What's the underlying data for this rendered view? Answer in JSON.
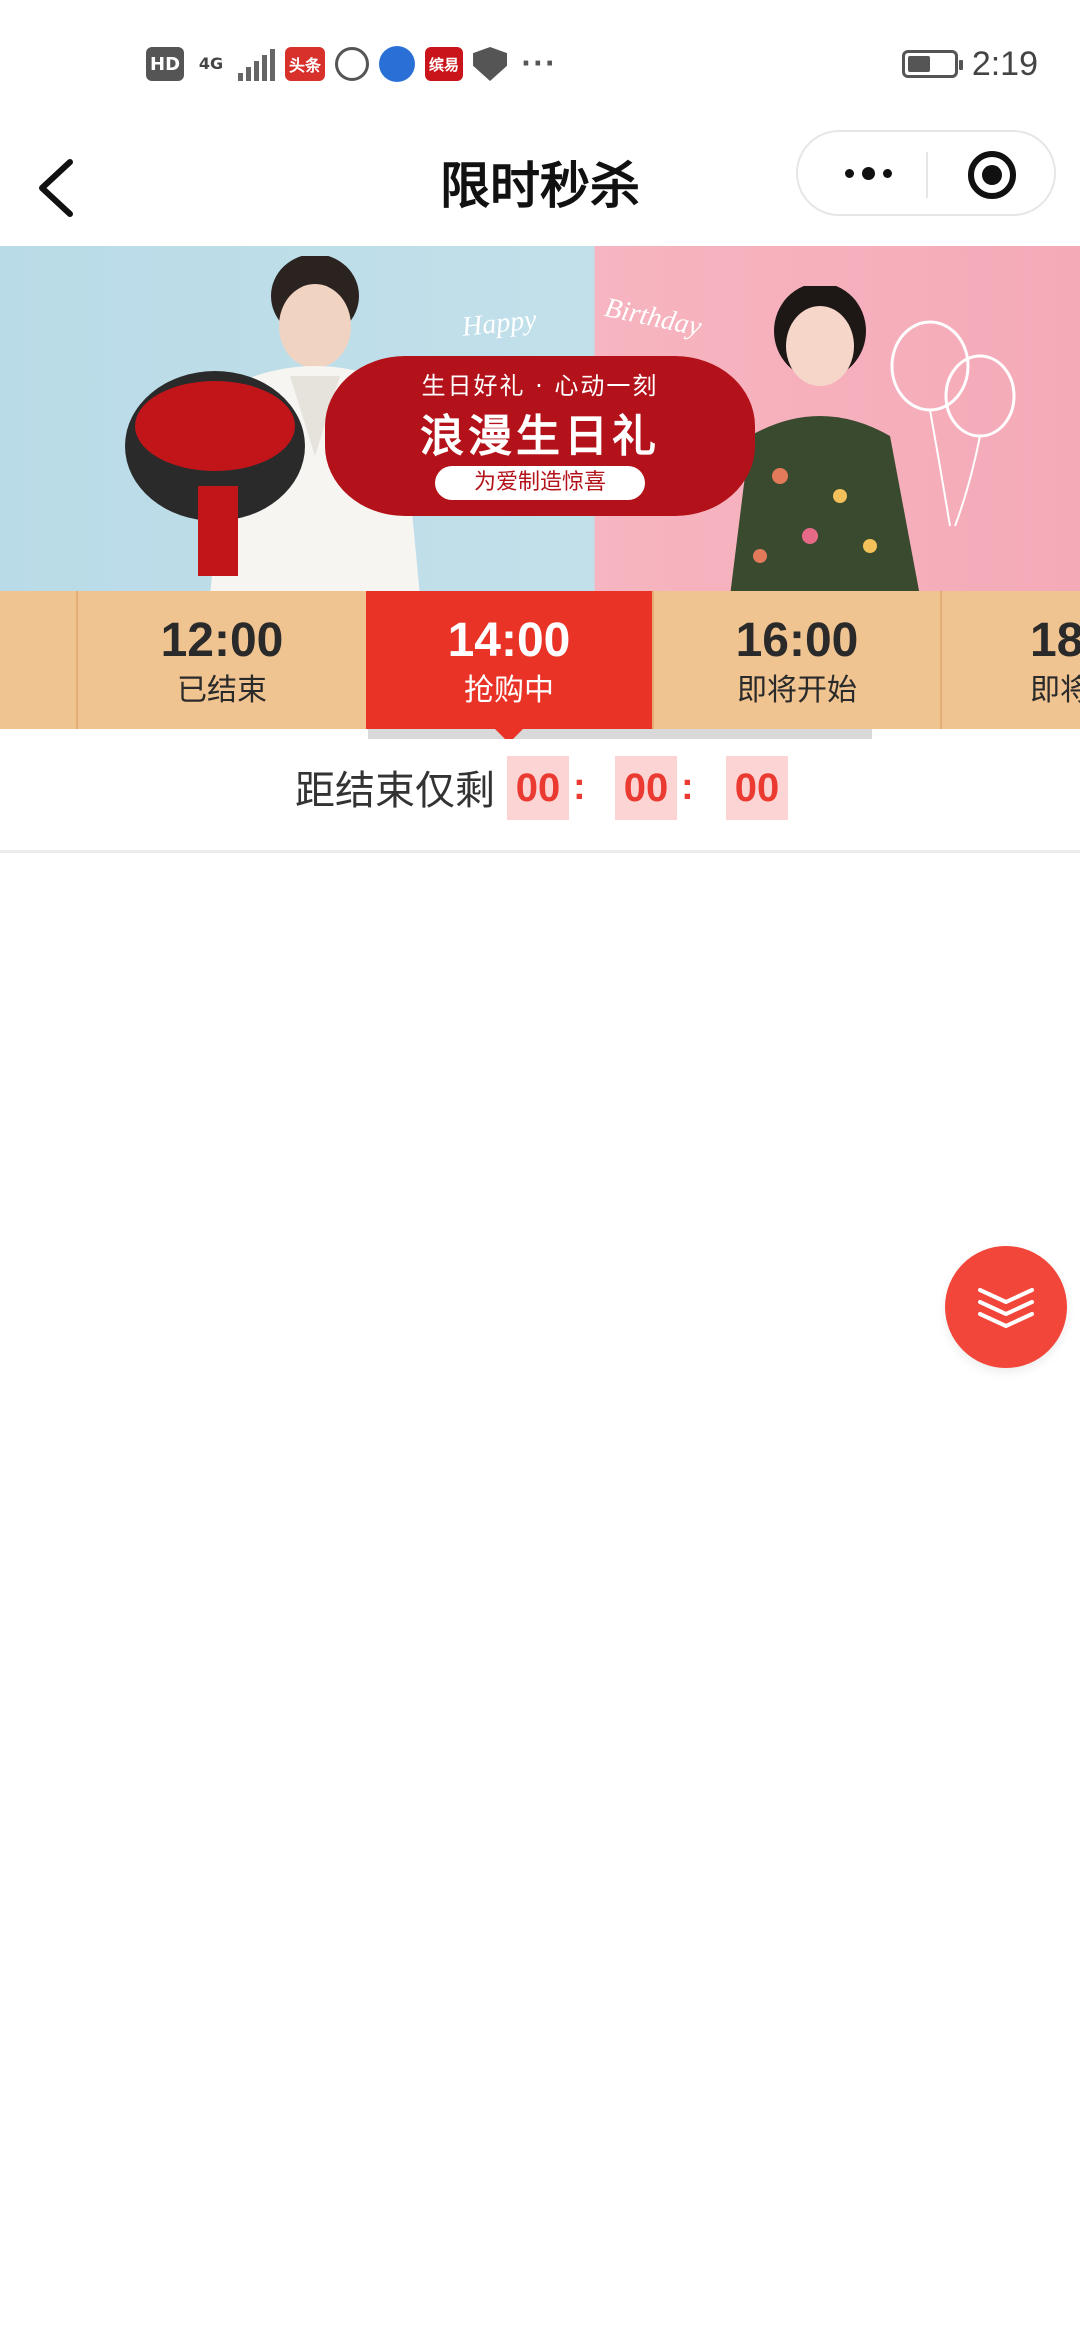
{
  "status_bar": {
    "time": "2:19",
    "left_icons": [
      "hd-icon",
      "4g-signal-icon",
      "toutiao-app-icon",
      "globe-icon",
      "app-blue-icon",
      "app-red-icon",
      "shield-icon",
      "more-dots-icon"
    ],
    "hd_label": "HD",
    "net_label": "4G",
    "toutiao_label": "头条",
    "red_app_label": "缤易"
  },
  "nav": {
    "title": "限时秒杀"
  },
  "banner": {
    "subtitle": "生日好礼 · 心动一刻",
    "headline": "浪漫生日礼",
    "pill": "为爱制造惊喜",
    "happy": "Happy",
    "birthday": "Birthday"
  },
  "time_tabs": [
    {
      "time": "12:00",
      "status": "已结束",
      "active": false
    },
    {
      "time": "14:00",
      "status": "抢购中",
      "active": true
    },
    {
      "time": "16:00",
      "status": "即将开始",
      "active": false
    },
    {
      "time": "18",
      "status": "即将",
      "active": false
    }
  ],
  "countdown": {
    "label": "距结束仅剩",
    "hours": "00",
    "minutes": "00",
    "seconds": "00",
    "sep1": ":",
    "sep2": ":"
  },
  "colors": {
    "accent": "#e83326",
    "tab_bg": "#f0c491",
    "countdown_box": "#fbd4d3",
    "fab": "#f2463a"
  }
}
